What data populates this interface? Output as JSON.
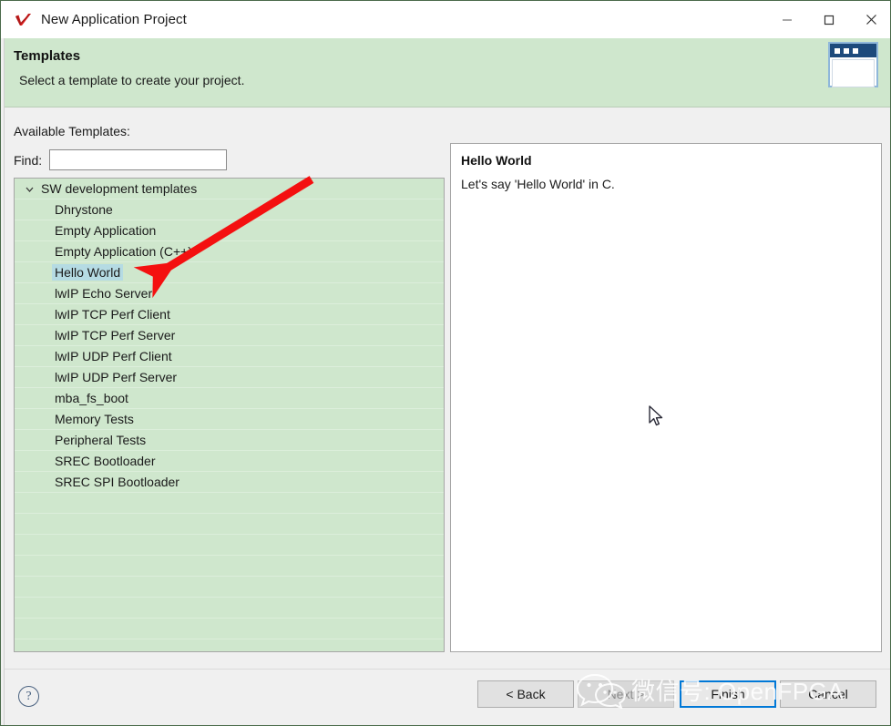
{
  "window": {
    "title": "New Application Project",
    "app_icon": "red-check-icon",
    "controls": {
      "minimize": "minimize-icon",
      "maximize": "maximize-icon",
      "close": "close-icon"
    }
  },
  "banner": {
    "title": "Templates",
    "subtitle": "Select a template to create your project.",
    "icon": "wizard-window-icon",
    "bg_color": "#cfe7cd"
  },
  "form": {
    "available_label": "Available Templates:",
    "find_label": "Find:",
    "find_value": "",
    "find_placeholder": "",
    "collapse_all_icon": "collapse-all-icon",
    "collapse_all_glyph": "−",
    "expand_all_icon": "expand-all-icon",
    "expand_all_glyph": "+"
  },
  "tree": {
    "root": {
      "label": "SW development templates",
      "expanded": true,
      "chevron": "chevron-down-icon"
    },
    "items": [
      {
        "label": "Dhrystone",
        "selected": false
      },
      {
        "label": "Empty Application",
        "selected": false
      },
      {
        "label": "Empty Application (C++)",
        "selected": false
      },
      {
        "label": "Hello World",
        "selected": true
      },
      {
        "label": "lwIP Echo Server",
        "selected": false
      },
      {
        "label": "lwIP TCP Perf Client",
        "selected": false
      },
      {
        "label": "lwIP TCP Perf Server",
        "selected": false
      },
      {
        "label": "lwIP UDP Perf Client",
        "selected": false
      },
      {
        "label": "lwIP UDP Perf Server",
        "selected": false
      },
      {
        "label": "mba_fs_boot",
        "selected": false
      },
      {
        "label": "Memory Tests",
        "selected": false
      },
      {
        "label": "Peripheral Tests",
        "selected": false
      },
      {
        "label": "SREC Bootloader",
        "selected": false
      },
      {
        "label": "SREC SPI Bootloader",
        "selected": false
      }
    ],
    "selection_color": "#b5dbe3",
    "bg_color": "#cfe7cd"
  },
  "description": {
    "title": "Hello World",
    "text": "Let's say 'Hello World' in C."
  },
  "footer": {
    "help_icon": "help-question-icon",
    "help_glyph": "?",
    "buttons": [
      {
        "label": "< Back",
        "state": "enabled"
      },
      {
        "label": "Next >",
        "state": "disabled"
      },
      {
        "label": "Finish",
        "state": "focused"
      },
      {
        "label": "Cancel",
        "state": "enabled"
      }
    ],
    "focus_color": "#0078d7"
  },
  "annotation": {
    "arrow_color": "#f41010",
    "arrow_from": "341,196",
    "arrow_to": "168,301"
  },
  "watermark": {
    "text": "微信号: OpenFPGA",
    "logo": "wechat-logo-icon"
  },
  "cursor": {
    "icon": "mouse-pointer-icon",
    "position": "713,448"
  }
}
